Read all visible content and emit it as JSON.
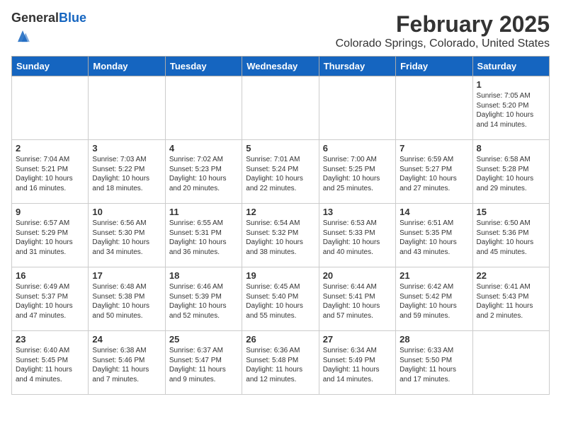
{
  "header": {
    "logo_general": "General",
    "logo_blue": "Blue",
    "title": "February 2025",
    "subtitle": "Colorado Springs, Colorado, United States"
  },
  "weekdays": [
    "Sunday",
    "Monday",
    "Tuesday",
    "Wednesday",
    "Thursday",
    "Friday",
    "Saturday"
  ],
  "weeks": [
    [
      {
        "day": "",
        "info": ""
      },
      {
        "day": "",
        "info": ""
      },
      {
        "day": "",
        "info": ""
      },
      {
        "day": "",
        "info": ""
      },
      {
        "day": "",
        "info": ""
      },
      {
        "day": "",
        "info": ""
      },
      {
        "day": "1",
        "info": "Sunrise: 7:05 AM\nSunset: 5:20 PM\nDaylight: 10 hours\nand 14 minutes."
      }
    ],
    [
      {
        "day": "2",
        "info": "Sunrise: 7:04 AM\nSunset: 5:21 PM\nDaylight: 10 hours\nand 16 minutes."
      },
      {
        "day": "3",
        "info": "Sunrise: 7:03 AM\nSunset: 5:22 PM\nDaylight: 10 hours\nand 18 minutes."
      },
      {
        "day": "4",
        "info": "Sunrise: 7:02 AM\nSunset: 5:23 PM\nDaylight: 10 hours\nand 20 minutes."
      },
      {
        "day": "5",
        "info": "Sunrise: 7:01 AM\nSunset: 5:24 PM\nDaylight: 10 hours\nand 22 minutes."
      },
      {
        "day": "6",
        "info": "Sunrise: 7:00 AM\nSunset: 5:25 PM\nDaylight: 10 hours\nand 25 minutes."
      },
      {
        "day": "7",
        "info": "Sunrise: 6:59 AM\nSunset: 5:27 PM\nDaylight: 10 hours\nand 27 minutes."
      },
      {
        "day": "8",
        "info": "Sunrise: 6:58 AM\nSunset: 5:28 PM\nDaylight: 10 hours\nand 29 minutes."
      }
    ],
    [
      {
        "day": "9",
        "info": "Sunrise: 6:57 AM\nSunset: 5:29 PM\nDaylight: 10 hours\nand 31 minutes."
      },
      {
        "day": "10",
        "info": "Sunrise: 6:56 AM\nSunset: 5:30 PM\nDaylight: 10 hours\nand 34 minutes."
      },
      {
        "day": "11",
        "info": "Sunrise: 6:55 AM\nSunset: 5:31 PM\nDaylight: 10 hours\nand 36 minutes."
      },
      {
        "day": "12",
        "info": "Sunrise: 6:54 AM\nSunset: 5:32 PM\nDaylight: 10 hours\nand 38 minutes."
      },
      {
        "day": "13",
        "info": "Sunrise: 6:53 AM\nSunset: 5:33 PM\nDaylight: 10 hours\nand 40 minutes."
      },
      {
        "day": "14",
        "info": "Sunrise: 6:51 AM\nSunset: 5:35 PM\nDaylight: 10 hours\nand 43 minutes."
      },
      {
        "day": "15",
        "info": "Sunrise: 6:50 AM\nSunset: 5:36 PM\nDaylight: 10 hours\nand 45 minutes."
      }
    ],
    [
      {
        "day": "16",
        "info": "Sunrise: 6:49 AM\nSunset: 5:37 PM\nDaylight: 10 hours\nand 47 minutes."
      },
      {
        "day": "17",
        "info": "Sunrise: 6:48 AM\nSunset: 5:38 PM\nDaylight: 10 hours\nand 50 minutes."
      },
      {
        "day": "18",
        "info": "Sunrise: 6:46 AM\nSunset: 5:39 PM\nDaylight: 10 hours\nand 52 minutes."
      },
      {
        "day": "19",
        "info": "Sunrise: 6:45 AM\nSunset: 5:40 PM\nDaylight: 10 hours\nand 55 minutes."
      },
      {
        "day": "20",
        "info": "Sunrise: 6:44 AM\nSunset: 5:41 PM\nDaylight: 10 hours\nand 57 minutes."
      },
      {
        "day": "21",
        "info": "Sunrise: 6:42 AM\nSunset: 5:42 PM\nDaylight: 10 hours\nand 59 minutes."
      },
      {
        "day": "22",
        "info": "Sunrise: 6:41 AM\nSunset: 5:43 PM\nDaylight: 11 hours\nand 2 minutes."
      }
    ],
    [
      {
        "day": "23",
        "info": "Sunrise: 6:40 AM\nSunset: 5:45 PM\nDaylight: 11 hours\nand 4 minutes."
      },
      {
        "day": "24",
        "info": "Sunrise: 6:38 AM\nSunset: 5:46 PM\nDaylight: 11 hours\nand 7 minutes."
      },
      {
        "day": "25",
        "info": "Sunrise: 6:37 AM\nSunset: 5:47 PM\nDaylight: 11 hours\nand 9 minutes."
      },
      {
        "day": "26",
        "info": "Sunrise: 6:36 AM\nSunset: 5:48 PM\nDaylight: 11 hours\nand 12 minutes."
      },
      {
        "day": "27",
        "info": "Sunrise: 6:34 AM\nSunset: 5:49 PM\nDaylight: 11 hours\nand 14 minutes."
      },
      {
        "day": "28",
        "info": "Sunrise: 6:33 AM\nSunset: 5:50 PM\nDaylight: 11 hours\nand 17 minutes."
      },
      {
        "day": "",
        "info": ""
      }
    ]
  ]
}
